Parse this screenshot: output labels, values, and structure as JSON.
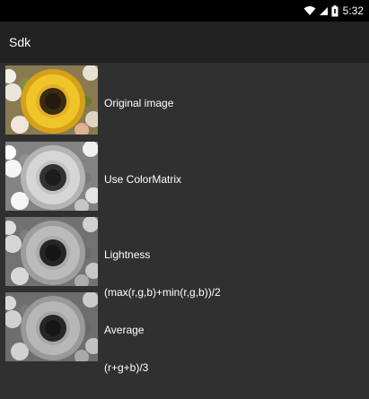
{
  "status_bar": {
    "time": "5:32",
    "icons": [
      "wifi-icon",
      "signal-icon",
      "battery-icon"
    ],
    "background": "#000000"
  },
  "app_bar": {
    "title": "Sdk",
    "background": "#212121"
  },
  "list": {
    "background": "#303030",
    "items": [
      {
        "lines": [
          "Original image"
        ],
        "image": "sunflower-color"
      },
      {
        "lines": [
          "Use ColorMatrix"
        ],
        "image": "sunflower-gray-colormatrix"
      },
      {
        "lines": [
          "Lightness",
          "(max(r,g,b)+min(r,g,b))/2"
        ],
        "image": "sunflower-gray-lightness"
      },
      {
        "lines": [
          "Average",
          "(r+g+b)/3"
        ],
        "image": "sunflower-gray-average"
      }
    ]
  }
}
